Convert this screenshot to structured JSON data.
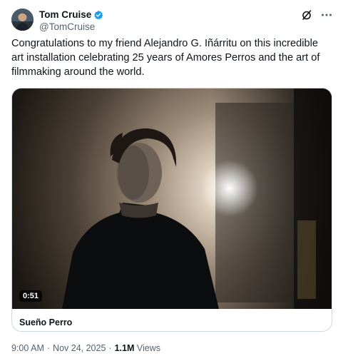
{
  "author": {
    "display_name": "Tom Cruise",
    "handle": "@TomCruise",
    "verified_color": "#1d9bf0"
  },
  "header_actions": {
    "grok_icon": "grok-icon",
    "more_icon": "more-icon"
  },
  "tweet": {
    "text": "Congratulations to my friend Alejandro G. Iñárritu on this incredible art installation celebrating 25 years of Amores Perros and the art of filmmaking around the world."
  },
  "media": {
    "duration": "0:51",
    "title": "Sueño Perro"
  },
  "meta": {
    "time": "9:00 AM",
    "date": "Nov 24, 2025",
    "separator": "·",
    "views_count": "1.1M",
    "views_label": "Views"
  }
}
